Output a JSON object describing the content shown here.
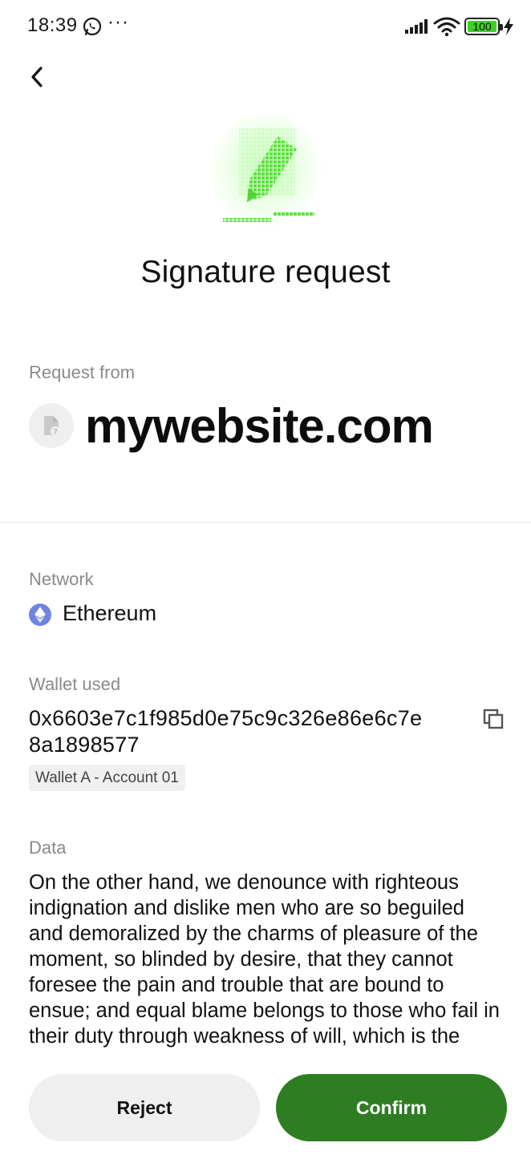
{
  "status_bar": {
    "time": "18:39",
    "dots": "···",
    "battery": "100"
  },
  "header": {
    "back_icon": "chevron-left-icon",
    "title": "Signature request"
  },
  "request": {
    "label": "Request from",
    "site": "mywebsite.com"
  },
  "network": {
    "label": "Network",
    "name": "Ethereum"
  },
  "wallet": {
    "label": "Wallet used",
    "address": "0x6603e7c1f985d0e75c9c326e86e6c7e8a1898577",
    "tag": "Wallet A - Account 01"
  },
  "data_section": {
    "label": "Data",
    "text": "On the other hand, we denounce with righteous indignation and dislike men who are so beguiled and demoralized by the charms of pleasure of the moment, so blinded by desire, that they cannot foresee the pain and trouble that are bound to ensue; and equal blame belongs to those who fail in their duty through weakness of will, which is the"
  },
  "actions": {
    "reject": "Reject",
    "confirm": "Confirm"
  },
  "colors": {
    "accent_green": "#2e7d22",
    "icon_green": "#5ee041",
    "ethereum": "#6f83e0"
  }
}
